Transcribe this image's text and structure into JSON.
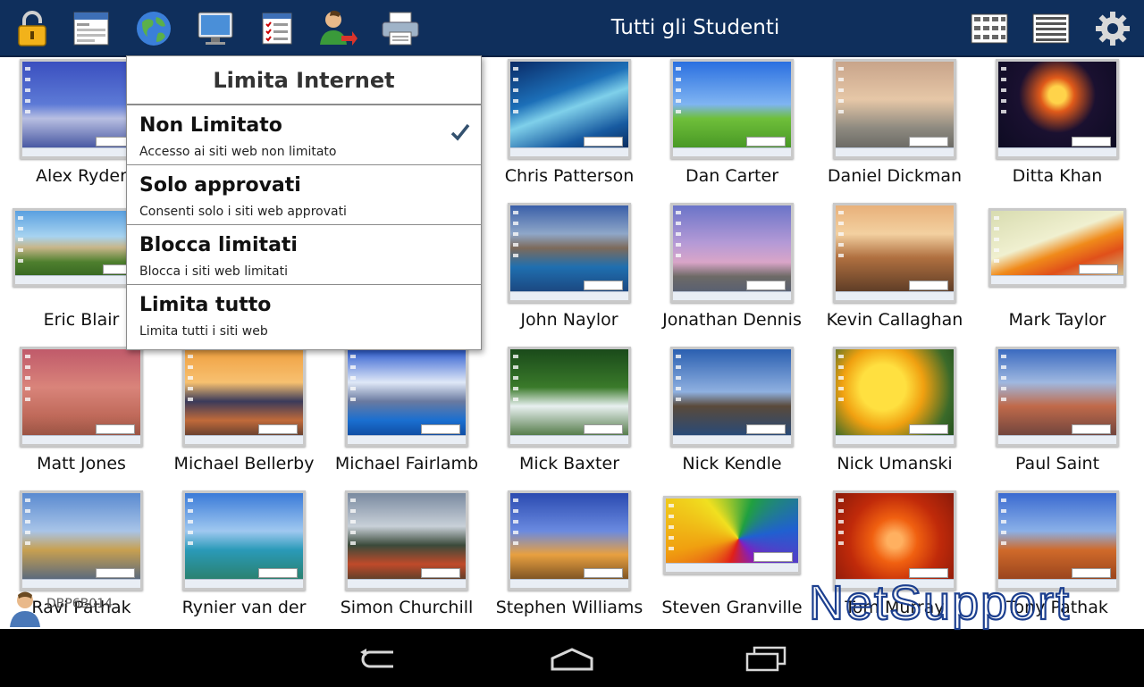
{
  "toolbar": {
    "title": "Tutti gli Studenti",
    "icons": [
      "lock-icon",
      "window-icon",
      "globe-icon",
      "monitor-icon",
      "checklist-icon",
      "user-remove-icon",
      "printer-icon",
      "grid-view-icon",
      "list-view-icon",
      "gear-icon"
    ]
  },
  "dropdown": {
    "title": "Limita Internet",
    "items": [
      {
        "title": "Non Limitato",
        "subtitle": "Accesso ai siti web non limitato",
        "selected": true
      },
      {
        "title": "Solo approvati",
        "subtitle": "Consenti solo i siti web approvati",
        "selected": false
      },
      {
        "title": "Blocca limitati",
        "subtitle": "Blocca i siti web limitati",
        "selected": false
      },
      {
        "title": "Limita tutto",
        "subtitle": "Limita tutti i siti web",
        "selected": false
      }
    ]
  },
  "students": [
    {
      "name": "Alex Ryder"
    },
    {
      "name": ""
    },
    {
      "name": ""
    },
    {
      "name": "Chris Patterson"
    },
    {
      "name": "Dan Carter"
    },
    {
      "name": "Daniel Dickman"
    },
    {
      "name": "Ditta Khan"
    },
    {
      "name": "Eric Blair"
    },
    {
      "name": ""
    },
    {
      "name": ""
    },
    {
      "name": "John Naylor"
    },
    {
      "name": "Jonathan Dennis"
    },
    {
      "name": "Kevin Callaghan"
    },
    {
      "name": "Mark Taylor"
    },
    {
      "name": "Matt Jones"
    },
    {
      "name": "Michael Bellerby"
    },
    {
      "name": "Michael Fairlamb"
    },
    {
      "name": "Mick Baxter"
    },
    {
      "name": "Nick Kendle"
    },
    {
      "name": "Nick Umanski"
    },
    {
      "name": "Paul Saint"
    },
    {
      "name": "Ravi Pathak"
    },
    {
      "name": "Rynier van der"
    },
    {
      "name": "Simon Churchill"
    },
    {
      "name": "Stephen Williams"
    },
    {
      "name": "Steven Granville"
    },
    {
      "name": "Tom Murray"
    },
    {
      "name": "Tony Pathak"
    }
  ],
  "machine_label": "DBP6B014",
  "watermark": "NetSupport",
  "colors": {
    "toolbar": "#0f2f5c",
    "check": "#33516f",
    "watermark": "#1c3f8f"
  }
}
